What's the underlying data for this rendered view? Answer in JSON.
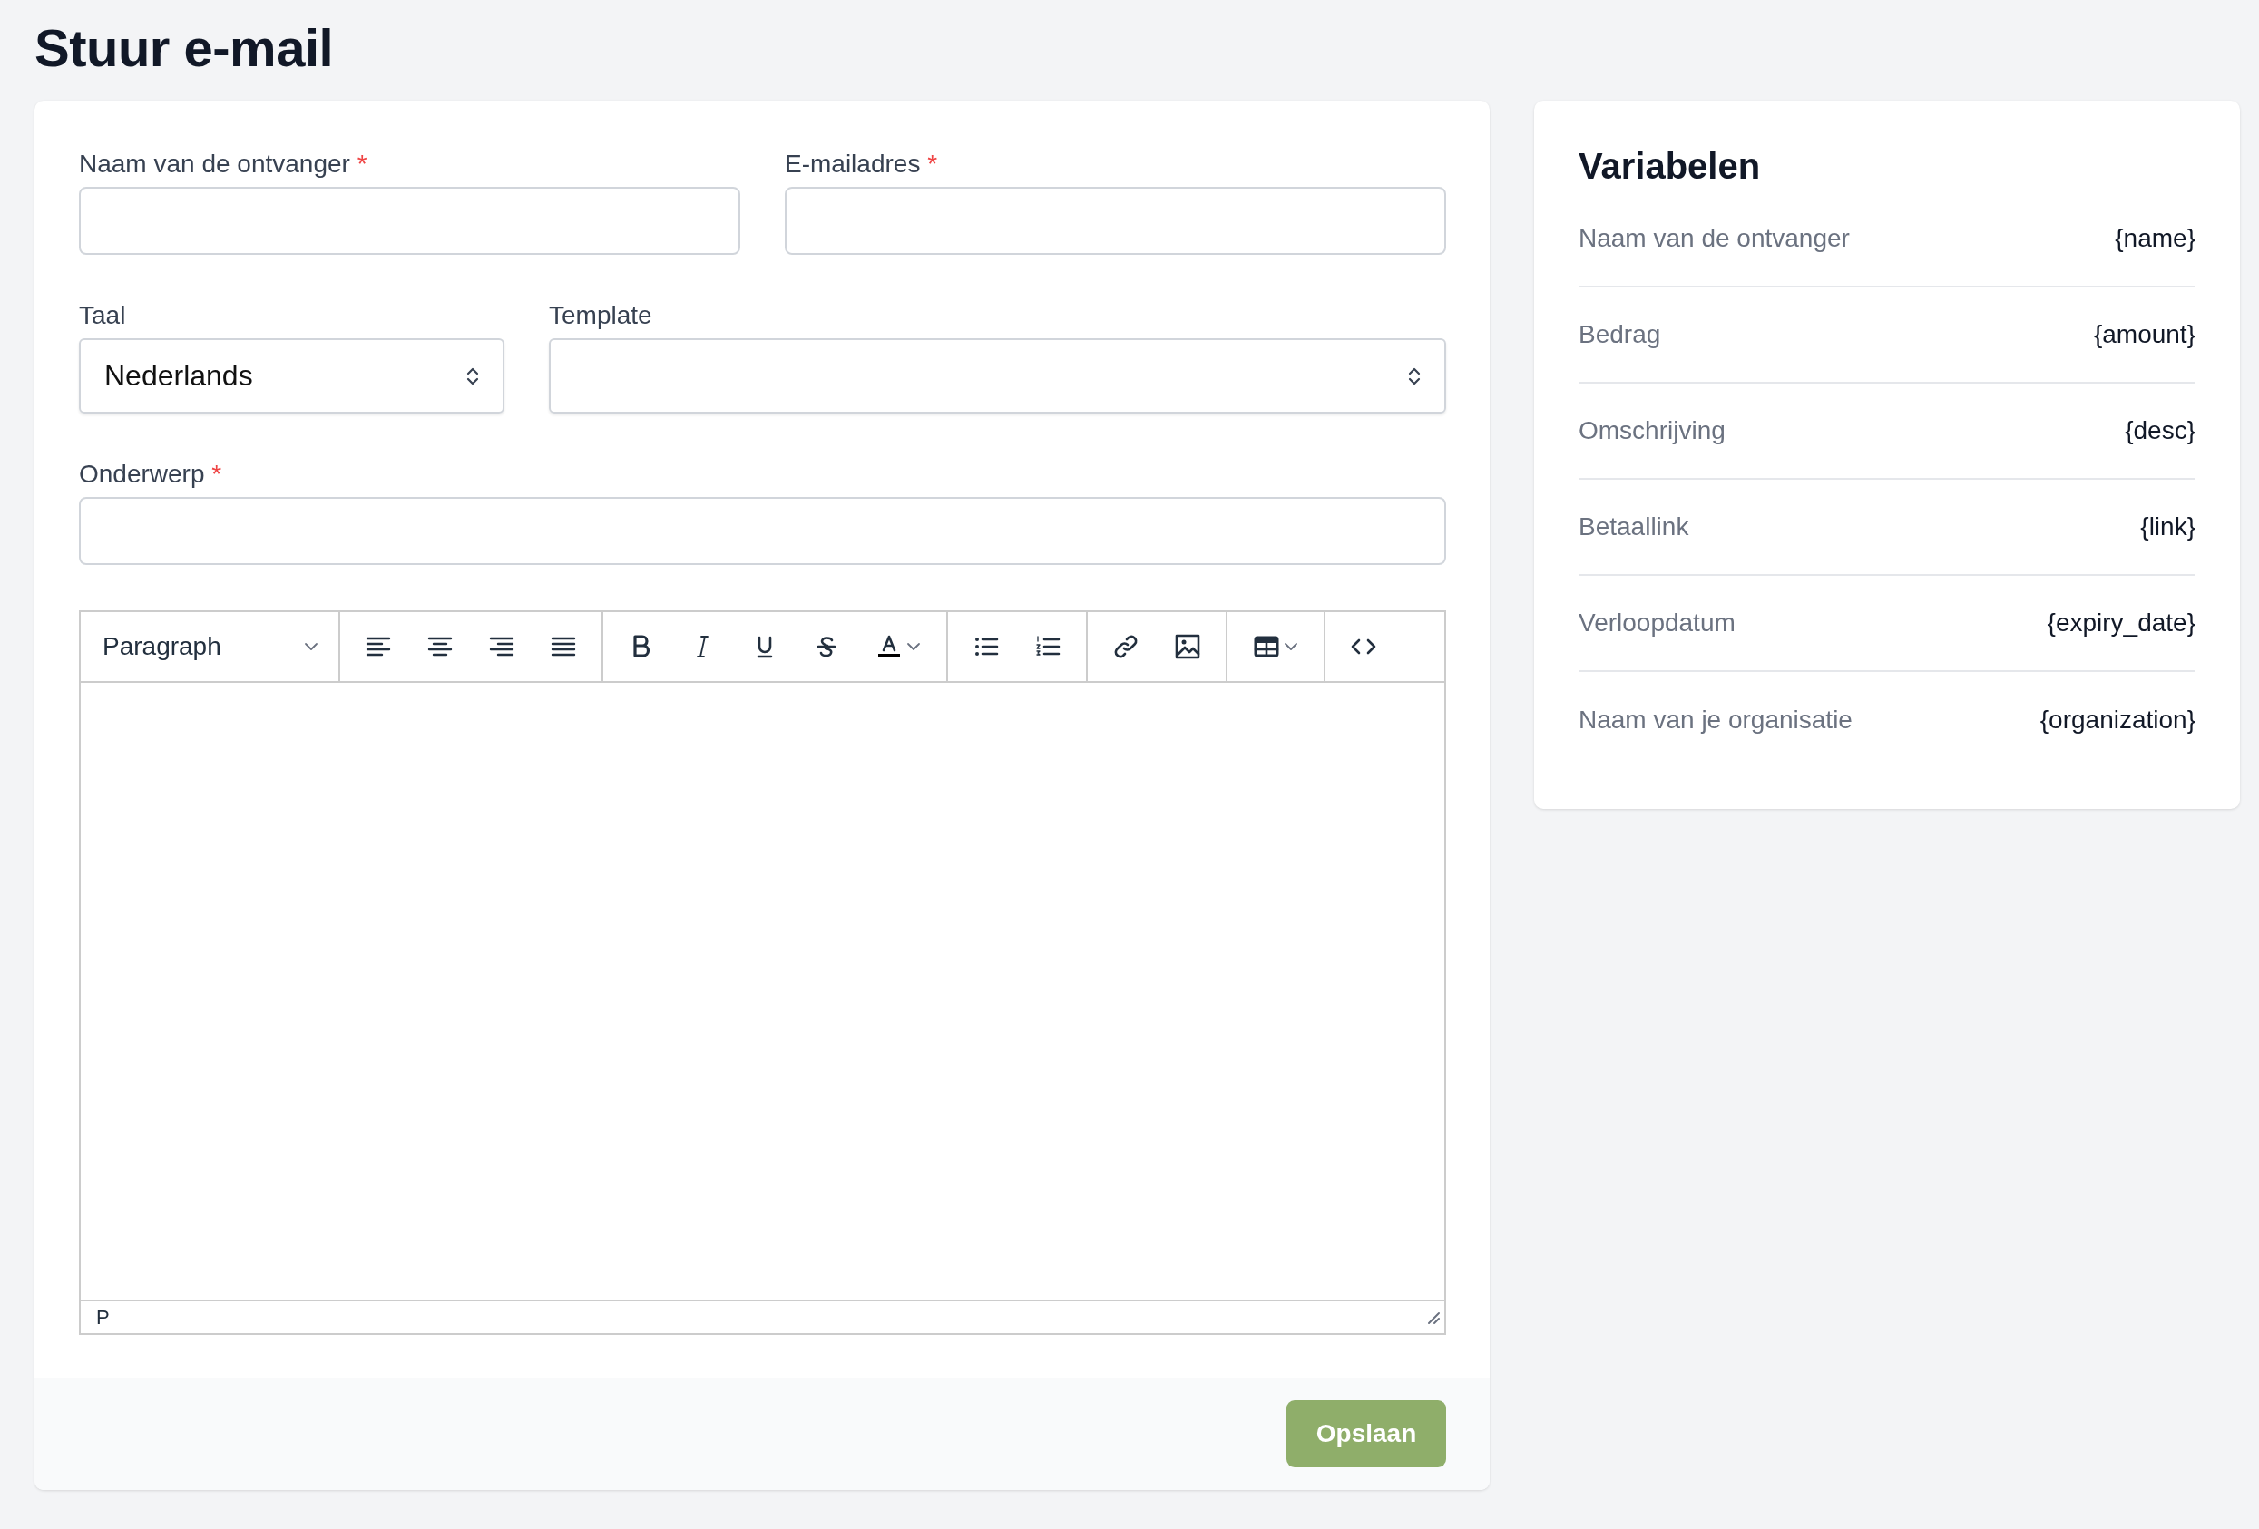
{
  "page": {
    "title": "Stuur e-mail"
  },
  "form": {
    "fields": [
      {
        "kind": "text",
        "label": "Naam van de ontvanger",
        "required_mark": "*"
      },
      {
        "kind": "text",
        "label": "E-mailadres",
        "required_mark": "*"
      },
      {
        "kind": "select",
        "label": "Taal",
        "value": "Nederlands"
      },
      {
        "kind": "select",
        "label": "Template"
      },
      {
        "kind": "text",
        "label": "Onderwerp",
        "required_mark": "*"
      }
    ],
    "editor": {
      "block_format": "Paragraph",
      "path": "P"
    },
    "save_button": "Opslaan"
  },
  "variables": {
    "title": "Variabelen",
    "items": [
      {
        "label": "Naam van de ontvanger",
        "token": "{name}"
      },
      {
        "label": "Bedrag",
        "token": "{amount}"
      },
      {
        "label": "Omschrijving",
        "token": "{desc}"
      },
      {
        "label": "Betaallink",
        "token": "{link}"
      },
      {
        "label": "Verloopdatum",
        "token": "{expiry_date}"
      },
      {
        "label": "Naam van je organisatie",
        "token": "{organization}"
      }
    ]
  }
}
